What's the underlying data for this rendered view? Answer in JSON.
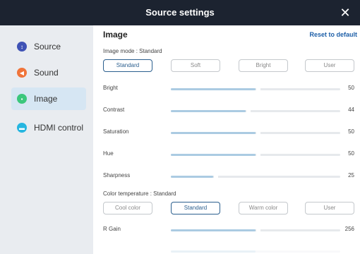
{
  "window": {
    "title": "Source settings",
    "close_glyph": "✕",
    "close_icon": "close-icon"
  },
  "sidebar": {
    "items": [
      {
        "label": "Source",
        "icon": "source-arrow-icon",
        "color": "#3f52b5",
        "glyph": "↕"
      },
      {
        "label": "Sound",
        "icon": "speaker-icon",
        "color": "#f0743a",
        "glyph": "◀"
      },
      {
        "label": "Image",
        "icon": "image-icon",
        "color": "#3bc77c",
        "glyph": "▪"
      },
      {
        "label": "HDMI control",
        "icon": "hdmi-icon",
        "color": "#26b6e0",
        "glyph": "▬"
      }
    ],
    "active_index": 2,
    "active_color": "#d6e6f3"
  },
  "main": {
    "heading": "Image",
    "reset_label": "Reset to default",
    "image_mode": {
      "label": "Image mode : Standard",
      "options": [
        "Standard",
        "Soft",
        "Bright",
        "User"
      ],
      "selected": "Standard"
    },
    "sliders": [
      {
        "name": "Bright",
        "value": 50,
        "max": 100
      },
      {
        "name": "Contrast",
        "value": 44,
        "max": 100
      },
      {
        "name": "Saturation",
        "value": 50,
        "max": 100
      },
      {
        "name": "Hue",
        "value": 50,
        "max": 100
      },
      {
        "name": "Sharpness",
        "value": 25,
        "max": 100
      }
    ],
    "color_temperature": {
      "label": "Color temperature : Standard",
      "options": [
        "Cool color",
        "Standard",
        "Warm color",
        "User"
      ],
      "selected": "Standard"
    },
    "gain_sliders": [
      {
        "name": "R Gain",
        "value": 256,
        "max": 512
      }
    ]
  },
  "colors": {
    "titlebar": "#1c2330",
    "accent": "#1d5fa8",
    "slider_fill": "#abcbe2"
  }
}
